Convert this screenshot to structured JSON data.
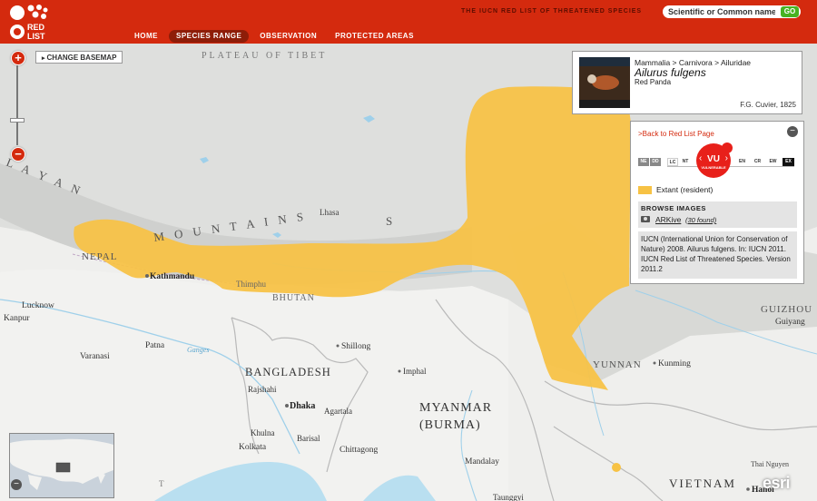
{
  "header": {
    "brand": "RED LIST",
    "tagline": "THE IUCN RED LIST OF THREATENED SPECIES",
    "search_placeholder": "Scientific or Common name",
    "search_go": "GO",
    "nav": [
      "HOME",
      "SPECIES RANGE",
      "OBSERVATION",
      "PROTECTED AREAS"
    ],
    "active_tab": "SPECIES RANGE"
  },
  "map_controls": {
    "zoom_in": "+",
    "zoom_out": "−",
    "change_basemap": "CHANGE BASEMAP"
  },
  "species": {
    "taxonomy": "Mammalia > Carnivora > Ailuridae",
    "scientific_name": "Ailurus fulgens",
    "common_name": "Red Panda",
    "authority": "F.G. Cuvier, 1825"
  },
  "panel": {
    "back_link": ">Back to Red List Page",
    "collapse": "−",
    "categories": [
      "NE",
      "DD",
      "LC",
      "NT",
      "VU",
      "EN",
      "CR",
      "EW",
      "EX"
    ],
    "current_category": "VU",
    "current_category_name": "VULNERABLE",
    "legend_label": "Extant (resident)",
    "legend_color": "#f7c244",
    "browse_title": "BROWSE IMAGES",
    "arkive_label": "ARKive",
    "arkive_count": "(30 found)",
    "citation": "IUCN (International Union for Conservation of Nature) 2008. Ailurus fulgens. In: IUCN 2011. IUCN Red List of Threatened Species. Version 2011.2"
  },
  "map": {
    "labels": {
      "plateau": "PLATEAU OF TIBET",
      "himalayas_left": "L A Y A N",
      "himalayas_right": "M O U N T A I N S",
      "lhasa": "Lhasa",
      "nepal": "NEPAL",
      "kathmandu": "Kathmandu",
      "thimphu": "Thimphu",
      "bhutan": "BHUTAN",
      "lucknow": "Lucknow",
      "kanpur": "Kanpur",
      "patna": "Patna",
      "ganges": "Ganges",
      "varanasi": "Varanasi",
      "shillong": "Shillong",
      "bangladesh": "BANGLADESH",
      "imphal": "Imphal",
      "rajshahi": "Rajshahi",
      "dhaka": "Dhaka",
      "agartala": "Agartala",
      "myanmar": "MYANMAR",
      "burma": "(BURMA)",
      "khulna": "Khulna",
      "kolkata": "Kolkata",
      "barisal": "Barisal",
      "chittagong": "Chittagong",
      "mandalay": "Mandalay",
      "taunggyi": "Taunggyi",
      "yunnan": "YUNNAN",
      "kunming": "Kunming",
      "guizhou": "GUIZHOU",
      "guiyang": "Guiyang",
      "vietnam": "VIETNAM",
      "thai_nguyen": "Thai Nguyen",
      "hanoi": "Hanoi",
      "s_letter": "S",
      "t_letter": "T"
    },
    "attribution": "esri"
  },
  "overview": {
    "close": "−"
  }
}
